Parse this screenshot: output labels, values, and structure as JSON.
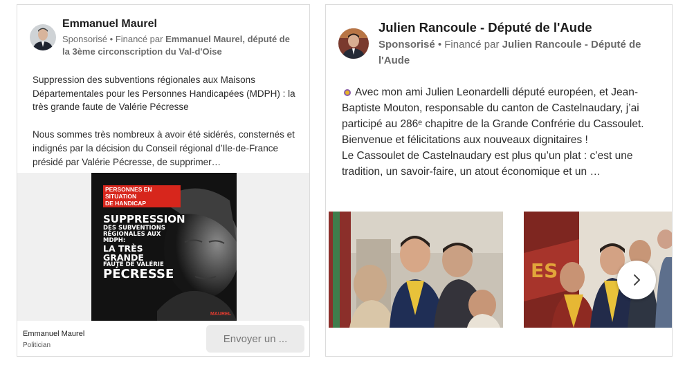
{
  "ad1": {
    "advertiser": "Emmanuel Maurel",
    "sponsored_label": "Sponsorisé",
    "funded_prefix": " • Financé par ",
    "funded_by": "Emmanuel Maurel, député de la 3ème circonscription du Val-d'Oise",
    "body_paragraph_1": "Suppression des subventions régionales aux Maisons Départementales pour les Personnes Handicapées (MDPH) : la très grande faute de Valérie Pécresse",
    "body_paragraph_2": "Nous sommes très nombreux à avoir été sidérés, consternés et indignés par la décision du Conseil régional d’Ile-de-France présidé par Valérie Pécresse, de supprimer…",
    "poster": {
      "tag_line_1": "PERSONNES EN SITUATION",
      "tag_line_2": "DE HANDICAP",
      "title_1": "SUPPRESSION",
      "title_2": "DES SUBVENTIONS",
      "title_3": "RÉGIONALES AUX MDPH:",
      "title_4": "LA TRÈS GRANDE",
      "title_5": "FAUTE DE VALÉRIE",
      "title_6": "PÉCRESSE",
      "logo_text": "MAUREL"
    },
    "footer_name": "Emmanuel Maurel",
    "footer_role": "Politician",
    "cta_label": "Envoyer un ..."
  },
  "ad2": {
    "advertiser": "Julien Rancoule - Député de l'Aude",
    "sponsored_label": "Sponsorisé",
    "funded_prefix": " • Financé par ",
    "funded_by": "Julien Rancoule - Député de l'Aude",
    "body_paragraph_1": "Avec mon ami Julien Leonardelli député européen, et Jean-Baptiste Mouton, responsable du canton de Castelnaudary, j’ai participé au 286ᵉ chapitre de la Grande Confrérie du Cassoulet. Bienvenue et félicitations aux nouveaux dignitaires !",
    "body_paragraph_2": "Le Cassoulet de Castelnaudary est plus qu’un plat : c’est une tradition, un savoir-faire, un atout économique et un …"
  },
  "icons": {
    "carousel_next": "chevron-right-icon",
    "bullet": "medal-icon"
  },
  "colors": {
    "poster_red": "#d7261c",
    "muted_text": "#6a6a6a",
    "cta_bg": "#ebebeb"
  }
}
